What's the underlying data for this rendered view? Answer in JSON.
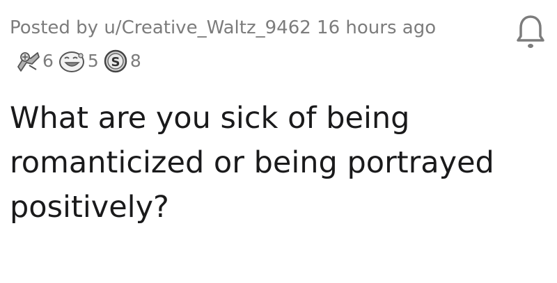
{
  "post": {
    "posted_by_prefix": "Posted by",
    "author": "u/Creative_Waltz_9462",
    "time_ago": "16 hours ago",
    "title": "What are you sick of being romanticized or being portrayed positively?"
  },
  "awards": [
    {
      "icon": "wholesome-seal-icon",
      "count": "6"
    },
    {
      "icon": "laughing-face-icon",
      "count": "5"
    },
    {
      "icon": "silver-coin-icon",
      "count": "8"
    }
  ],
  "actions": {
    "follow_icon": "bell-icon"
  },
  "colors": {
    "meta_text": "#7c7c7c",
    "title_text": "#1a1a1b",
    "background": "#ffffff"
  }
}
